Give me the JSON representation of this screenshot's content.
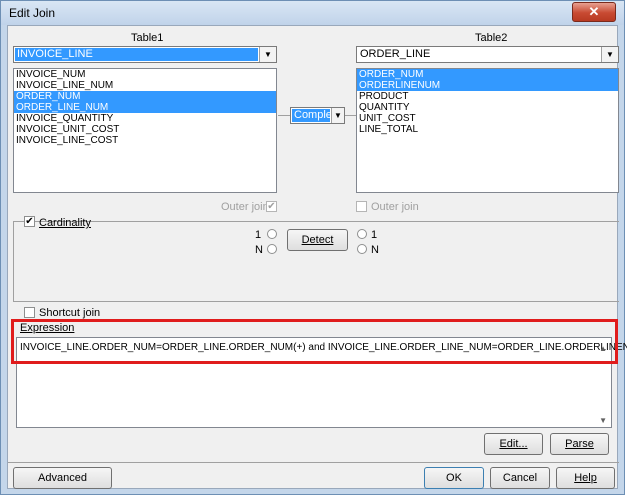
{
  "window": {
    "title": "Edit Join",
    "close_glyph": "✕"
  },
  "table1": {
    "label": "Table1",
    "selected": "INVOICE_LINE",
    "columns": [
      {
        "name": "INVOICE_NUM",
        "selected": false
      },
      {
        "name": "INVOICE_LINE_NUM",
        "selected": false
      },
      {
        "name": "ORDER_NUM",
        "selected": true
      },
      {
        "name": "ORDER_LINE_NUM",
        "selected": true
      },
      {
        "name": "INVOICE_QUANTITY",
        "selected": false
      },
      {
        "name": "INVOICE_UNIT_COST",
        "selected": false
      },
      {
        "name": "INVOICE_LINE_COST",
        "selected": false
      }
    ],
    "outer_join_label": "Outer join",
    "outer_join_checked": true
  },
  "table2": {
    "label": "Table2",
    "selected": "ORDER_LINE",
    "columns": [
      {
        "name": "ORDER_NUM",
        "selected": true
      },
      {
        "name": "ORDERLINENUM",
        "selected": true
      },
      {
        "name": "PRODUCT",
        "selected": false
      },
      {
        "name": "QUANTITY",
        "selected": false
      },
      {
        "name": "UNIT_COST",
        "selected": false
      },
      {
        "name": "LINE_TOTAL",
        "selected": false
      }
    ],
    "outer_join_label": "Outer join",
    "outer_join_checked": false
  },
  "operator": {
    "value": "Complex"
  },
  "cardinality": {
    "label": "Cardinality",
    "checked": true,
    "left_one": "1",
    "left_n": "N",
    "right_one": "1",
    "right_n": "N",
    "detect_label": "Detect"
  },
  "shortcut_join": {
    "label": "Shortcut join",
    "checked": false
  },
  "expression": {
    "label": "Expression",
    "text": "INVOICE_LINE.ORDER_NUM=ORDER_LINE.ORDER_NUM(+) and INVOICE_LINE.ORDER_LINE_NUM=ORDER_LINE.ORDERLINENUM(+)"
  },
  "buttons": {
    "edit": "Edit...",
    "parse": "Parse",
    "advanced": "Advanced",
    "ok": "OK",
    "cancel": "Cancel",
    "help": "Help"
  },
  "colors": {
    "selection": "#3399ff",
    "highlight_box": "#e01c1c"
  }
}
